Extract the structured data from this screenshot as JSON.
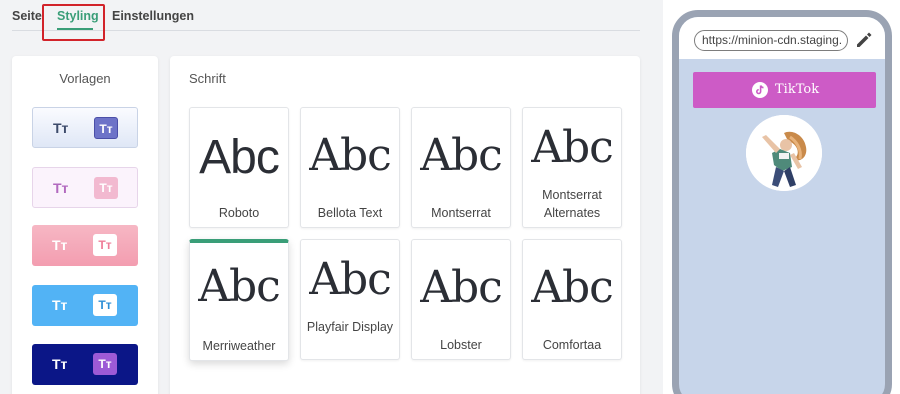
{
  "tabs": [
    {
      "label": "Seite"
    },
    {
      "label": "Styling",
      "active": true
    },
    {
      "label": "Einstellungen"
    }
  ],
  "vorlagen": {
    "title": "Vorlagen",
    "templates": [
      {
        "label": "Tт",
        "badge": "Tт"
      },
      {
        "label": "Tт",
        "badge": "Tт"
      },
      {
        "label": "Tт",
        "badge": "Tт"
      },
      {
        "label": "Tт",
        "badge": "Tт"
      },
      {
        "label": "Tт",
        "badge": "Tт"
      }
    ]
  },
  "schrift": {
    "title": "Schrift",
    "sample": "Abc",
    "fonts": [
      {
        "name": "Roboto"
      },
      {
        "name": "Bellota Text"
      },
      {
        "name": "Montserrat"
      },
      {
        "name": "Montserrat Alternates"
      },
      {
        "name": "Merriweather",
        "selected": true
      },
      {
        "name": "Playfair Display"
      },
      {
        "name": "Lobster"
      },
      {
        "name": "Comfortaa"
      }
    ]
  },
  "preview": {
    "url": "https://minion-cdn.staging.",
    "button_label": "TikTok",
    "icons": {
      "edit": "pencil-icon",
      "tiktok": "tiktok-icon"
    }
  },
  "colors": {
    "accent": "#3a9e78",
    "highlight": "#d2232a",
    "tiktok_button": "#cd5bc6",
    "phone_bg": "#c7d5ea"
  }
}
